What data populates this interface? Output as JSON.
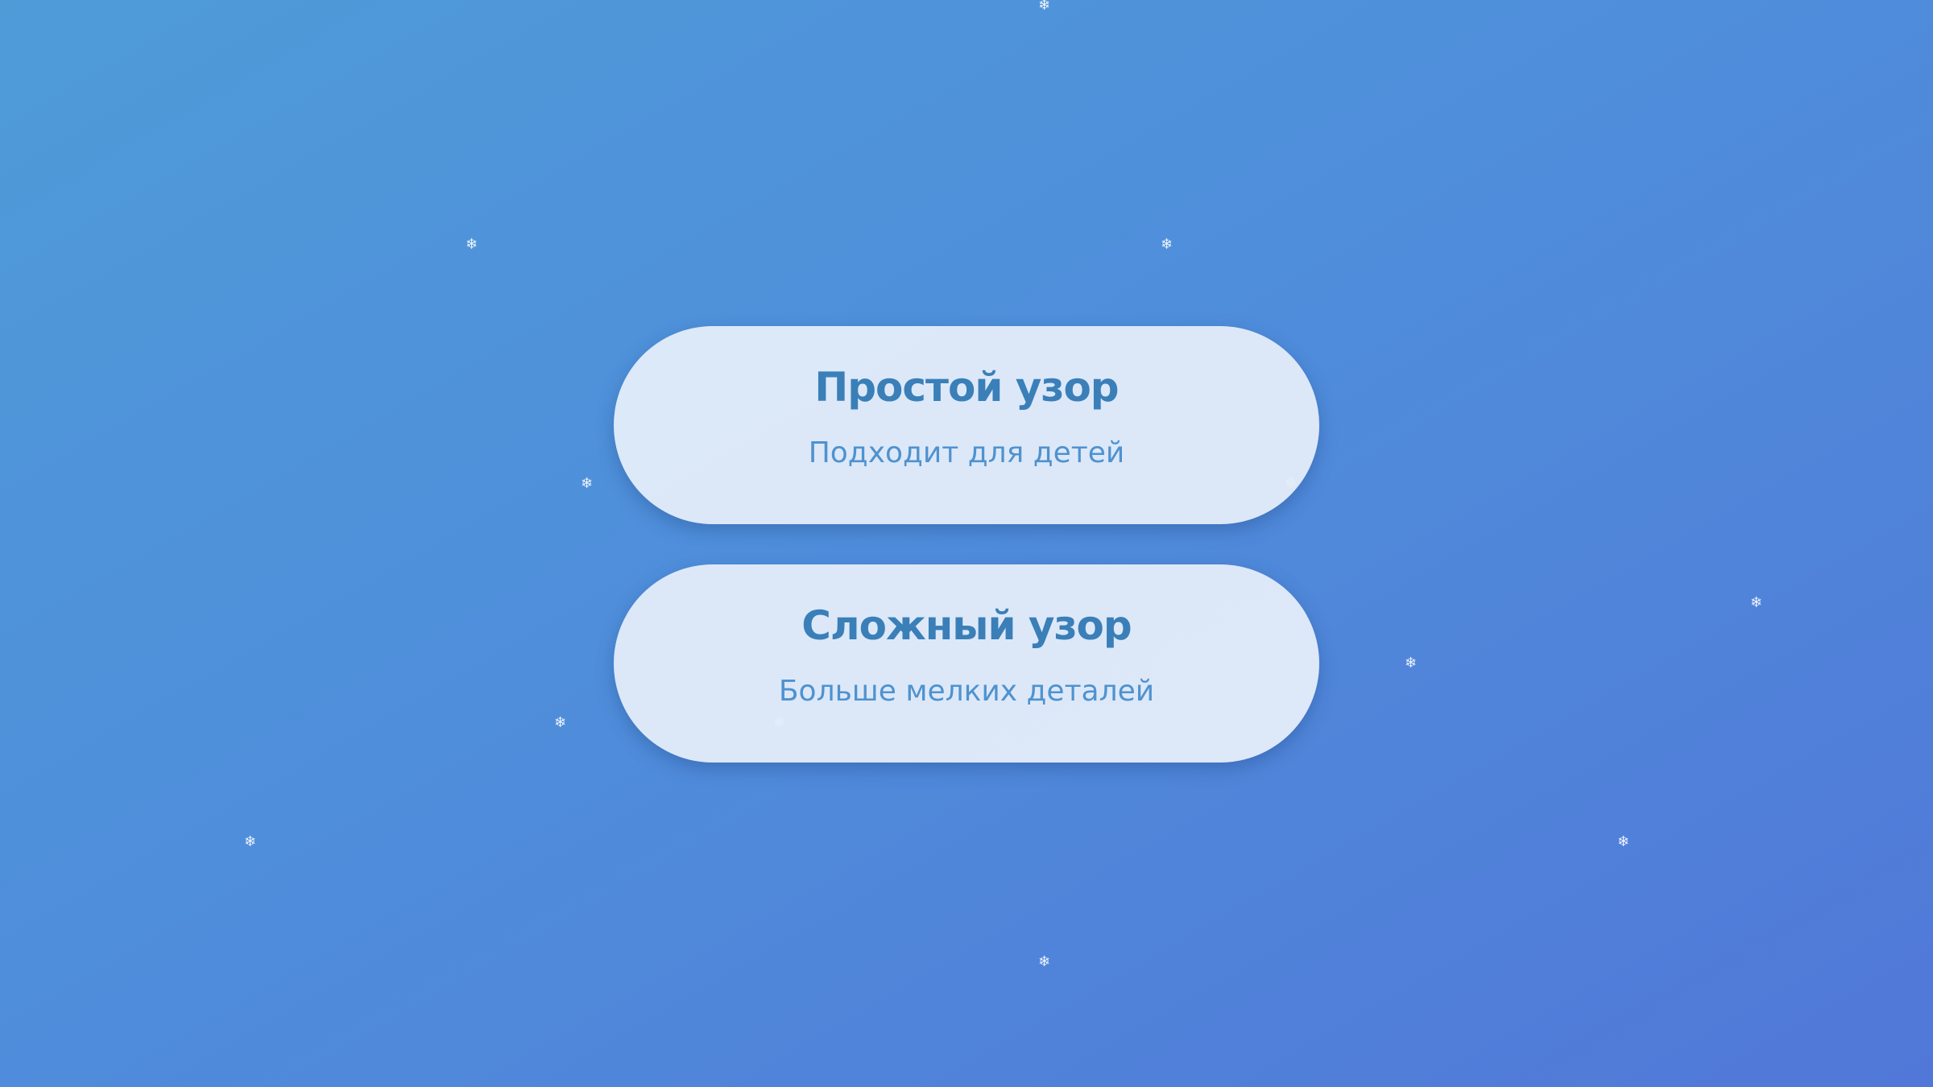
{
  "options": [
    {
      "title": "Простой узор",
      "subtitle": "Подходит для детей"
    },
    {
      "title": "Сложный узор",
      "subtitle": "Больше мелких деталей"
    }
  ],
  "decor": {
    "snowflake_glyph": "❄",
    "icon": "snowflake-icon"
  },
  "colors": {
    "background_start": "#4f9bd8",
    "background_end": "#5178d8",
    "card": "#e6eefa",
    "title": "#3a7fb8",
    "subtitle": "#4f92cf"
  }
}
